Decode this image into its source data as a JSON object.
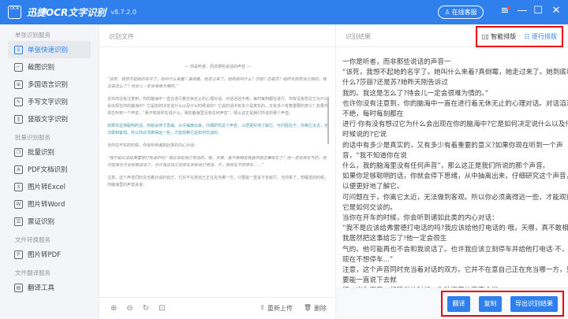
{
  "app": {
    "logo_text": "OCR",
    "title": "迅捷OCR文字识别",
    "version": "v8.7.2.0",
    "service": "在线客服",
    "menu_icon": "menu-icon",
    "minimize": "—",
    "maximize": "☐",
    "close": "✕"
  },
  "sidebar": {
    "sections": [
      {
        "title": "单张识别服务",
        "items": [
          {
            "label": "单张快速识别",
            "icon": "S",
            "active": true
          },
          {
            "label": "截图识别",
            "icon": "⌐"
          },
          {
            "label": "多国语言识别",
            "icon": "⊕"
          },
          {
            "label": "手写文字识别",
            "icon": "✎"
          },
          {
            "label": "竖版文字识别",
            "icon": "‖"
          }
        ]
      },
      {
        "title": "批量识别服务",
        "items": [
          {
            "label": "批量识别",
            "icon": "❐"
          },
          {
            "label": "PDF文档识别",
            "icon": "A"
          },
          {
            "label": "图片转Excel",
            "icon": "X"
          },
          {
            "label": "图片转Word",
            "icon": "W"
          },
          {
            "label": "票证识别",
            "icon": "☰"
          }
        ]
      },
      {
        "title": "文件转换服务",
        "items": [
          {
            "label": "图片转PDF",
            "icon": "P"
          }
        ]
      },
      {
        "title": "文件翻译服务",
        "items": [
          {
            "label": "翻译工具",
            "icon": "▤"
          }
        ]
      }
    ]
  },
  "left_panel": {
    "title": "识别文件",
    "preview": {
      "heading": "— 你是听者，而非那些说话的声音 —",
      "p1": "“该死，我想不起她的名字了。她叫什么来着？真倒霉，她走过来了。她到底叫什么？莎丽？还是苏？她昨天刚告诉过我的。我这是怎么了？待会儿一定会很难为情的。”",
      "p2": "也许你没有注意到，你的脑海中一直在进行着无休无止的心理对话。对话滔滔不绝，每时每刻都在进行。你有没有想过它为什么会出现在你的脑海中？它是如何决定说什么以及什么时候说的？它说的话中有多少是真实的，又有多少有着重要的意义？如果你现在听到一个声音，“我不知道你在说什么，我的脑海里没有任何声音”，那么这正是我们所说的那个声音。",
      "p3": "如果你足够聪明的话，你就会停下思绪，从中抽离出来，仔细研究这个声音，以便更好地了解它。可问题在于，你离它太近，无法做到客观。所以你必须离得远一些，才能观察它是如何交谈的。",
      "p4": "当你在开车的时候，你会听到诸如此类的内心对话：",
      "p5": "“我不是应该给弗雷德打电话的吗？我应该给他打电话的。哦，天哪，真不敢相信我居然把这事给忘了！他一定会很生气的。他可能再也不会和我说话了。也许我应该立刻停车并给他打电话。不，我现在不想停车……”",
      "p6": "注意，这个声音同时充当着对话的双方。它并不在意自己正在充当哪一方，只要能一直说下去就行。当你累了，想睡觉的时候，你脑海里的声音会说："
    },
    "tools": {
      "zoom_in": "⊕",
      "zoom_out": "⊖",
      "rotate": "↻",
      "fit": "⊡",
      "reupload": "重新上传",
      "delete": "删除"
    }
  },
  "right_panel": {
    "title": "识别结果",
    "layout_smart": "智能排版",
    "layout_line": "逐行排版",
    "lines": [
      "一你是听者，而非那些说话的声音一",
      "“该死，我想不起她的名字了。她叫什么来着?真倒霉，她走过来了。她到底叫",
      "什么?莎丽?还是苏?她昨天刚告诉过",
      "我的。我这是怎么了?待会儿一定会很难为情的。”",
      "也许你没有注意到，你的脑海中一直在进行着无休无止的心理对话。对话滔滔",
      "不绝，每时每刻都在",
      "进行·你有没有想过它为什么会出现在你的脑海中?它是如何决定说什么以及什么",
      "时候说的?它说",
      "的话中有多少是真实的，又有多少有着重要的意义?如果你现在听到一个声",
      "音，“我不知道你在说",
      "什么，我的脑海里没有任何声音”，那么这正是我们所说的那个声音。",
      "如果你足够聪明的话，你就会停下思绪，从中抽离出来，仔细研究这个声音，",
      "以便更好地了解它。",
      "可问题在于，你离它太近，无法做到客观。所以你必须离得远一些，才能观察",
      "它是如何交谈的。",
      "当你在开车的时候，你会听到诸如此类的内心对话：",
      "“我不是应该给弗雷德打电话的吗?我应该给他打电话的·哦，天哪，真不敢相信",
      "我居然把这事给忘了!他一定会很生",
      "气的。他可能再也不会和我说话了。也许我应该立刻停车并给他打电话·不，我",
      "现在不想停车...”",
      "注意，这个声音同时充当着对话的双方。它并不在意自己正在充当哪一方，只",
      "要能一直说下去就",
      "行。当你累了，想睡觉的时候，你脑海里的声音会说："
    ],
    "actions": {
      "translate": "翻译",
      "copy": "复制",
      "export": "导出识别结果"
    }
  }
}
